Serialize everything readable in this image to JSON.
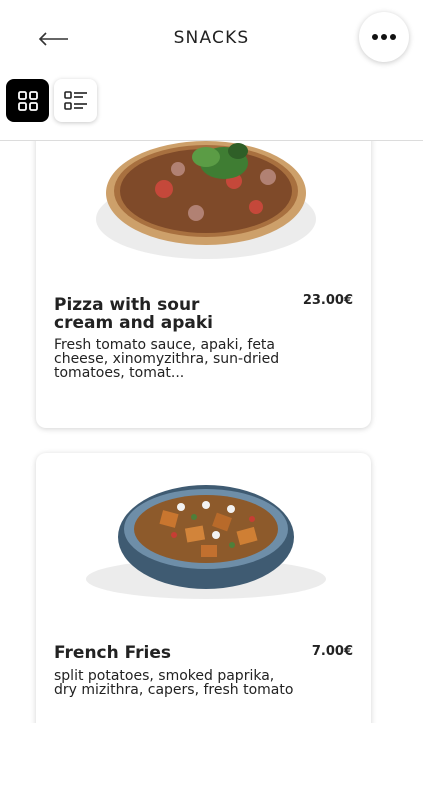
{
  "header": {
    "title": "SNACKS",
    "back_icon": "arrow-left-icon",
    "more_icon": "more-horizontal-icon"
  },
  "view_toggle": {
    "active": "grid",
    "grid_icon": "grid-icon",
    "list_icon": "list-icon"
  },
  "colors": {
    "accent": "#000000",
    "card_bg": "#ffffff",
    "divider": "#dcdcdc"
  },
  "products": [
    {
      "name": "Pizza with sour cream and apaki",
      "price": "23.00€",
      "description": "Fresh tomato sauce, apaki, feta cheese, xinomyzithra, sun-dried tomatoes, tomat..."
    },
    {
      "name": "French Fries",
      "price": "7.00€",
      "description": "split potatoes, smoked paprika, dry mizithra, capers, fresh tomato"
    }
  ]
}
